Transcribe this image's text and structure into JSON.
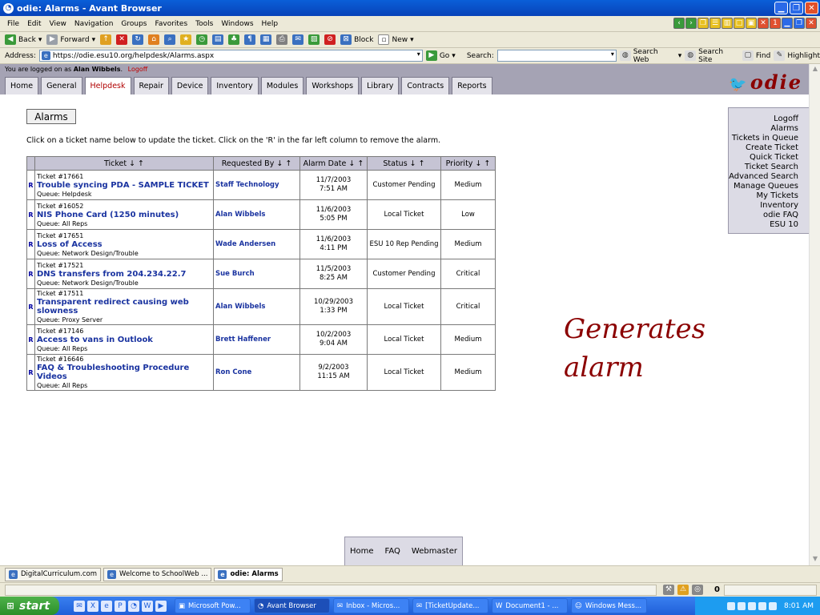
{
  "window": {
    "title": "odie: Alarms - Avant Browser"
  },
  "menu": [
    "File",
    "Edit",
    "View",
    "Navigation",
    "Groups",
    "Favorites",
    "Tools",
    "Windows",
    "Help"
  ],
  "toolbar": {
    "back": "Back",
    "forward": "Forward",
    "block": "Block",
    "new": "New"
  },
  "address": {
    "label": "Address:",
    "url": "https://odie.esu10.org/helpdesk/Alarms.aspx",
    "go": "Go",
    "search_label": "Search:",
    "search_value": "",
    "search_web": "Search Web",
    "search_site": "Search Site",
    "find": "Find",
    "highlight": "Highlight"
  },
  "site": {
    "logged_in_prefix": "You are logged on as",
    "user": "Alan Wibbels",
    "logoff": "Logoff",
    "logo": "odie",
    "tabs": [
      "Home",
      "General",
      "Helpdesk",
      "Repair",
      "Device",
      "Inventory",
      "Modules",
      "Workshops",
      "Library",
      "Contracts",
      "Reports"
    ],
    "active_tab": "Helpdesk"
  },
  "main": {
    "heading": "Alarms",
    "instructions": "Click on a ticket name below to update the ticket. Click on the 'R' in the far left column to remove the alarm.",
    "columns": [
      "Ticket ↓ ↑",
      "Requested By ↓ ↑",
      "Alarm Date ↓ ↑",
      "Status ↓ ↑",
      "Priority ↓ ↑"
    ],
    "remove_label": "R",
    "rows": [
      {
        "number": "Ticket #17661",
        "name": "Trouble syncing PDA - SAMPLE TICKET",
        "queue": "Queue: Helpdesk",
        "requested_by": "Staff Technology",
        "date": "11/7/2003",
        "time": "7:51 AM",
        "status": "Customer Pending",
        "priority": "Medium"
      },
      {
        "number": "Ticket #16052",
        "name": "NIS Phone Card (1250 minutes)",
        "queue": "Queue: All Reps",
        "requested_by": "Alan Wibbels",
        "date": "11/6/2003",
        "time": "5:05 PM",
        "status": "Local Ticket",
        "priority": "Low"
      },
      {
        "number": "Ticket #17651",
        "name": "Loss of Access",
        "queue": "Queue: Network Design/Trouble",
        "requested_by": "Wade Andersen",
        "date": "11/6/2003",
        "time": "4:11 PM",
        "status": "ESU 10 Rep Pending",
        "priority": "Medium"
      },
      {
        "number": "Ticket #17521",
        "name": "DNS transfers from 204.234.22.7",
        "queue": "Queue: Network Design/Trouble",
        "requested_by": "Sue Burch",
        "date": "11/5/2003",
        "time": "8:25 AM",
        "status": "Customer Pending",
        "priority": "Critical"
      },
      {
        "number": "Ticket #17511",
        "name": "Transparent redirect causing web slowness",
        "queue": "Queue: Proxy Server",
        "requested_by": "Alan Wibbels",
        "date": "10/29/2003",
        "time": "1:33 PM",
        "status": "Local Ticket",
        "priority": "Critical"
      },
      {
        "number": "Ticket #17146",
        "name": "Access to vans in Outlook",
        "queue": "Queue: All Reps",
        "requested_by": "Brett Haffener",
        "date": "10/2/2003",
        "time": "9:04 AM",
        "status": "Local Ticket",
        "priority": "Medium"
      },
      {
        "number": "Ticket #16646",
        "name": "FAQ & Troubleshooting Procedure Videos",
        "queue": "Queue: All Reps",
        "requested_by": "Ron Cone",
        "date": "9/2/2003",
        "time": "11:15 AM",
        "status": "Local Ticket",
        "priority": "Medium"
      }
    ]
  },
  "sidemenu": [
    "Logoff",
    "Alarms",
    "Tickets in Queue",
    "Create Ticket",
    "Quick Ticket",
    "Ticket Search",
    "Advanced Search",
    "Manage Queues",
    "My Tickets",
    "Inventory",
    "odie FAQ",
    "ESU 10"
  ],
  "callout": {
    "line1": "Generates",
    "line2": "alarm"
  },
  "footer": [
    "Home",
    "FAQ",
    "Webmaster"
  ],
  "browser_tabs": [
    "DigitalCurriculum.com",
    "Welcome to SchoolWeb ...",
    "odie: Alarms"
  ],
  "status": {
    "count": "0"
  },
  "taskbar": {
    "start": "start",
    "tasks": [
      "Microsoft Pow...",
      "Avant Browser",
      "Inbox - Micros...",
      "[TicketUpdate...",
      "Document1 - ...",
      "Windows Mess..."
    ],
    "active_task": "Avant Browser",
    "clock": "8:01 AM"
  }
}
